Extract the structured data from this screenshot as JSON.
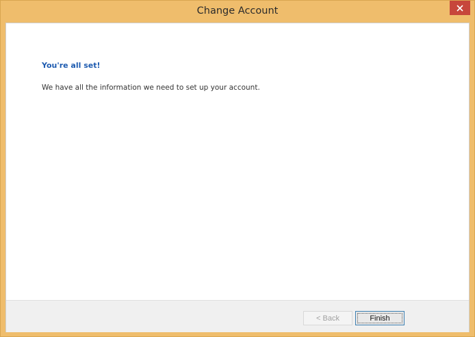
{
  "window": {
    "title": "Change Account",
    "close_icon": "close-icon",
    "accent_color": "#efbd6c",
    "close_color": "#c7463b"
  },
  "content": {
    "heading": "You're all set!",
    "message": "We have all the information we need to set up your account.",
    "heading_color": "#1e5bb0"
  },
  "footer": {
    "back_label": "< Back",
    "back_enabled": false,
    "finish_label": "Finish"
  }
}
